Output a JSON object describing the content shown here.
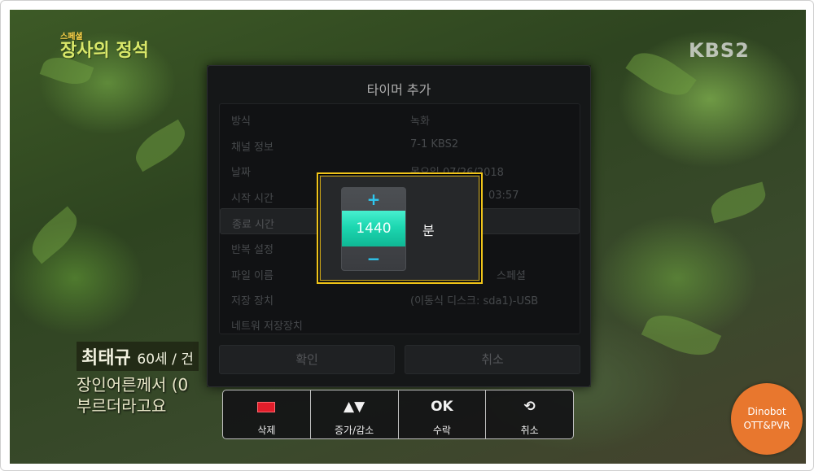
{
  "tv": {
    "corner_logo_small": "스페셜",
    "corner_logo": "장사의 정석",
    "channel_logo": "KBS2",
    "caption_name": "최태규",
    "caption_age": "60세 / 건",
    "caption_line1": "장인어른께서 (0",
    "caption_line2": "부르더라고요"
  },
  "dialog": {
    "title": "타이머 추가",
    "rows": [
      {
        "label": "방식",
        "value": "녹화"
      },
      {
        "label": "채널 정보",
        "value": "7-1  KBS2"
      },
      {
        "label": "날짜",
        "value": "목요일 07/26/2018"
      },
      {
        "label": "시작 시간",
        "value": "03:57"
      },
      {
        "label": "종료 시간",
        "value": ""
      },
      {
        "label": "반복 설정",
        "value": ""
      },
      {
        "label": "파일 이름",
        "value": "스페셜"
      },
      {
        "label": "저장 장치",
        "value": "(이동식 디스크: sda1)-USB"
      },
      {
        "label": "네트워 저장장치",
        "value": ""
      }
    ],
    "confirm_label": "확인",
    "cancel_label": "취소"
  },
  "picker": {
    "up_symbol": "+",
    "value": "1440",
    "down_symbol": "−",
    "unit": "분"
  },
  "hintbar": [
    {
      "icon": "red-key-icon",
      "glyph": "",
      "label": "삭제"
    },
    {
      "icon": "up-down-arrows-icon",
      "glyph": "▲▼",
      "label": "증가/감소"
    },
    {
      "icon": "ok-icon",
      "glyph": "OK",
      "label": "수락"
    },
    {
      "icon": "back-icon",
      "glyph": "⟲",
      "label": "취소"
    }
  ],
  "watermark": {
    "line1": "Dinobot",
    "line2": "OTT&PVR",
    "color": "#e8772e"
  },
  "colors": {
    "accent_focus": "#f0c419",
    "picker_value_bg": "#1dd7b1",
    "picker_arrows": "#2ec8f0"
  }
}
